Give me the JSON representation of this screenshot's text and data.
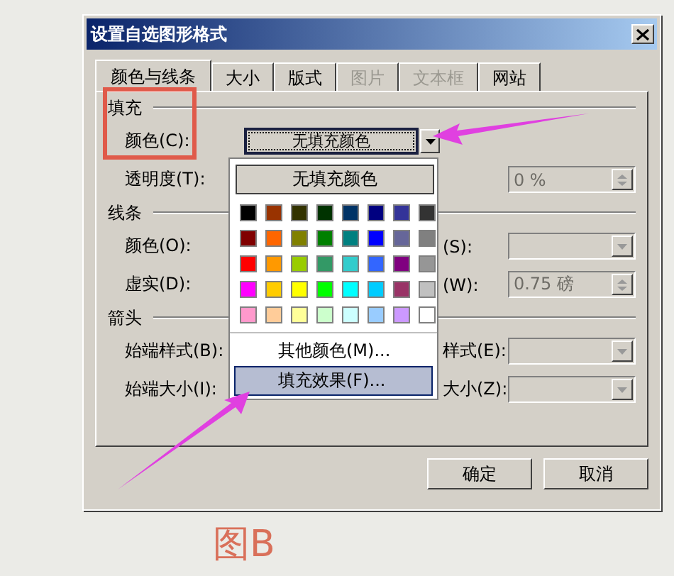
{
  "window": {
    "title": "设置自选图形格式"
  },
  "tabs": [
    {
      "label": "颜色与线条",
      "selected": true,
      "disabled": false
    },
    {
      "label": "大小",
      "selected": false,
      "disabled": false
    },
    {
      "label": "版式",
      "selected": false,
      "disabled": false
    },
    {
      "label": "图片",
      "selected": false,
      "disabled": true
    },
    {
      "label": "文本框",
      "selected": false,
      "disabled": true
    },
    {
      "label": "网站",
      "selected": false,
      "disabled": false
    }
  ],
  "sections": [
    {
      "title": "填充",
      "rows": [
        {
          "label": "颜色(C):",
          "field": {
            "kind": "color-dropdown",
            "value": "无填充颜色"
          }
        },
        {
          "label": "透明度(T):",
          "right": {
            "field": {
              "kind": "spinner",
              "value": "0 %",
              "disabled": true
            }
          }
        }
      ]
    },
    {
      "title": "线条",
      "rows": [
        {
          "label": "颜色(O):",
          "right": {
            "label": "(S):",
            "field": {
              "kind": "dropdown",
              "disabled": true
            }
          }
        },
        {
          "label": "虚实(D):",
          "right": {
            "label": "(W):",
            "field": {
              "kind": "spinner",
              "value": "0.75 磅",
              "disabled": true
            }
          }
        }
      ]
    },
    {
      "title": "箭头",
      "rows": [
        {
          "label": "始端样式(B):",
          "right": {
            "label": "样式(E):",
            "field": {
              "kind": "dropdown",
              "disabled": true
            }
          }
        },
        {
          "label": "始端大小(I):",
          "right": {
            "label": "大小(Z):",
            "field": {
              "kind": "dropdown",
              "disabled": true
            }
          }
        }
      ]
    }
  ],
  "popup": {
    "none_button": "无填充颜色",
    "swatches": [
      {
        "color": "#000000"
      },
      {
        "color": "#993300"
      },
      {
        "color": "#333300"
      },
      {
        "color": "#003300"
      },
      {
        "color": "#003366"
      },
      {
        "color": "#000080"
      },
      {
        "color": "#333399"
      },
      {
        "color": "#333333"
      },
      {
        "color": "#800000"
      },
      {
        "color": "#ff6600"
      },
      {
        "color": "#808000"
      },
      {
        "color": "#008000"
      },
      {
        "color": "#008080"
      },
      {
        "color": "#0000ff"
      },
      {
        "color": "#666699"
      },
      {
        "color": "#808080"
      },
      {
        "color": "#ff0000"
      },
      {
        "color": "#ff9900"
      },
      {
        "color": "#99cc00"
      },
      {
        "color": "#339966"
      },
      {
        "color": "#33cccc"
      },
      {
        "color": "#3366ff"
      },
      {
        "color": "#800080"
      },
      {
        "color": "#969696"
      },
      {
        "color": "#ff00ff"
      },
      {
        "color": "#ffcc00"
      },
      {
        "color": "#ffff00"
      },
      {
        "color": "#00ff00"
      },
      {
        "color": "#00ffff"
      },
      {
        "color": "#00ccff"
      },
      {
        "color": "#993366"
      },
      {
        "color": "#c0c0c0"
      },
      {
        "color": "#ff99cc"
      },
      {
        "color": "#ffcc99"
      },
      {
        "color": "#ffff99"
      },
      {
        "color": "#ccffcc"
      },
      {
        "color": "#ccffff"
      },
      {
        "color": "#99ccff"
      },
      {
        "color": "#cc99ff"
      },
      {
        "color": "#ffffff"
      }
    ],
    "items": [
      {
        "label": "其他颜色(M)...",
        "selected": false
      },
      {
        "label": "填充效果(F)...",
        "selected": true
      }
    ]
  },
  "buttons": [
    {
      "label": "确定"
    },
    {
      "label": "取消"
    }
  ],
  "caption": "图B"
}
